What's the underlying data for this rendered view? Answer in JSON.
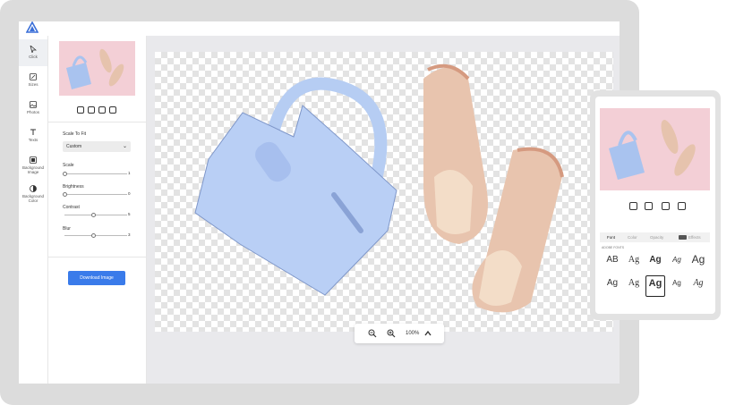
{
  "colors": {
    "accent": "#3a7bea",
    "thumb_bg": "#f3cfd6",
    "workspace_bg": "#e9e9ec"
  },
  "app": {
    "logo": "logo-triangle-icon"
  },
  "rail": {
    "items": [
      {
        "label": "Click",
        "icon": "cursor-icon"
      },
      {
        "label": "Sizes",
        "icon": "resize-icon"
      },
      {
        "label": "Photos",
        "icon": "image-icon"
      },
      {
        "label": "Texts",
        "icon": "text-icon"
      },
      {
        "label": "Background Image",
        "icon": "bg-image-icon"
      },
      {
        "label": "Background Color",
        "icon": "bg-color-icon"
      }
    ]
  },
  "panel": {
    "scale_to_fit_label": "Scale To Fit",
    "scale_to_fit_value": "Custom",
    "sliders": [
      {
        "label": "Scale",
        "value": "1",
        "level": 0
      },
      {
        "label": "Brightness",
        "value": "0",
        "level": 0
      },
      {
        "label": "Contrast",
        "value": "5",
        "level": 0.45
      },
      {
        "label": "Blur",
        "value": "3",
        "level": 0.45
      }
    ],
    "download_button": "Download Image"
  },
  "zoom": {
    "value": "100%"
  },
  "mobile": {
    "tabs": [
      "Font",
      "Color",
      "Opacity",
      "Effects"
    ],
    "section_title": "ADOBE FONTS",
    "font_samples": [
      "AB",
      "Ag",
      "Ag",
      "Ag",
      "Ag",
      "Ag",
      "Ag",
      "Ag",
      "Ag",
      "Ag"
    ]
  }
}
